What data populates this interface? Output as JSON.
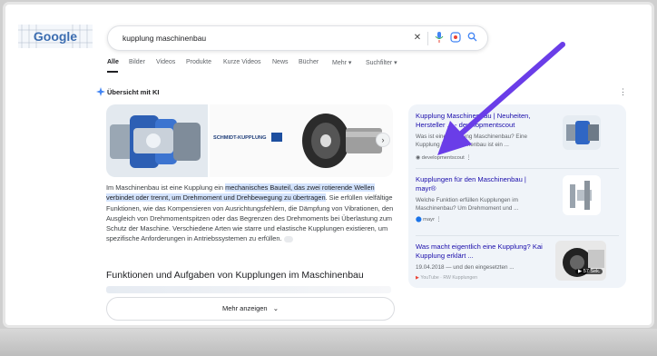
{
  "logo": {
    "text": "Google"
  },
  "search": {
    "query": "kupplung maschinenbau"
  },
  "tabs": [
    "Alle",
    "Bilder",
    "Videos",
    "Produkte",
    "Kurze Videos",
    "News",
    "Bücher",
    "Mehr ▾",
    "Suchfilter ▾"
  ],
  "ai": {
    "heading": "Übersicht mit KI",
    "image_brand": "SCHMIDT-KUPPLUNG",
    "body_pre": "Im Maschinenbau ist eine Kupplung ein ",
    "body_hl": "mechanisches Bauteil, das zwei rotierende Wellen verbindet oder trennt, um Drehmoment und Drehbewegung zu übertragen",
    "body_post": ". Sie erfüllen vielfältige Funktionen, wie das Kompensieren von Ausrichtungsfehlern, die Dämpfung von Vibrationen, den Ausgleich von Drehmomentspitzen oder das Begrenzen des Drehmoments bei Überlastung zum Schutz der Maschine. Verschiedene Arten wie starre und elastische Kupplungen existieren, um spezifische Anforderungen in Antriebssystemen zu erfüllen.",
    "subheading": "Funktionen und Aufgaben von Kupplungen im Maschinenbau",
    "more_button": "Mehr anzeigen"
  },
  "sources": [
    {
      "title": "Kupplung Maschinenbau | Neuheiten, Hersteller ... - developmentscout",
      "desc": "Was ist eine Kupplung Maschinenbau? Eine Kupplung im Maschinenbau ist ein ...",
      "site": "developmentscout"
    },
    {
      "title": "Kupplungen für den Maschinenbau | mayr®",
      "desc": "Welche Funktion erfüllen Kupplungen im Maschinenbau? Um Drehmoment und ...",
      "site": "mayr"
    },
    {
      "title": "Was macht eigentlich eine Kupplung? Kai Kupplung erklärt ...",
      "desc": "19.04.2018 — und den eingesetzten ...",
      "site": "YouTube · RW Kupplungen",
      "duration": "▶ 57 Sek."
    }
  ],
  "colors": {
    "link": "#1a0dab",
    "highlight": "#d3e3fd",
    "arrow": "#6a3de8",
    "side_bg": "#f0f4f9"
  }
}
